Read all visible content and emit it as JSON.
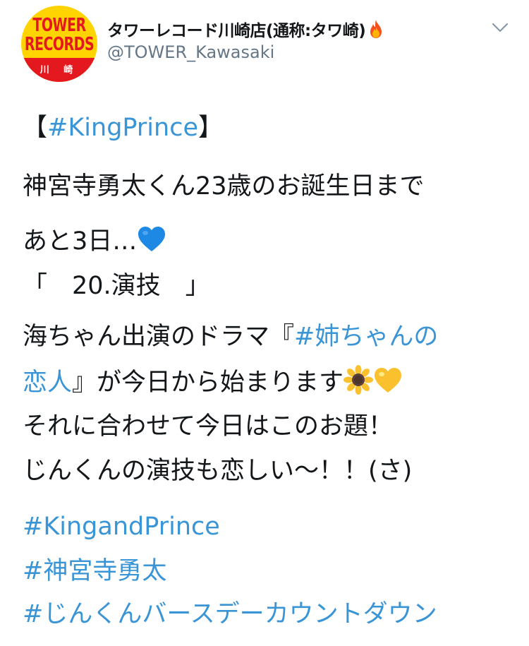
{
  "user": {
    "display_name": "タワーレコード川崎店(通称:タワ崎)",
    "handle": "@TOWER_Kawasaki",
    "avatar": {
      "logo_line1": "TOWER",
      "logo_line2": "RECORDS",
      "branch": "川 崎"
    },
    "name_emoji": "fire-icon"
  },
  "tweet": {
    "l1_open": "【",
    "l1_tag": "#KingPrince",
    "l1_close": "】",
    "l2": "神宮寺勇太くん23歳のお誕生日まで",
    "l3": "あと3日…",
    "l3_emoji": "blue-heart-icon",
    "l4": "「　20.演技　」",
    "l5_pre": "海ちゃん出演のドラマ『",
    "l5_tag": "#姉ちゃんの",
    "l6_tag": "恋人",
    "l6_post": "』が今日から始まります",
    "l6_emojis": [
      "sunflower-icon",
      "yellow-heart-icon"
    ],
    "l7": "それに合わせて今日はこのお題！",
    "l8": "じんくんの演技も恋しい〜！！(さ)",
    "hashtags": [
      "#KingandPrince",
      "#神宮寺勇太",
      "#じんくんバースデーカウントダウン"
    ]
  },
  "colors": {
    "link": "#3a95d6",
    "text": "#14171a",
    "secondary": "#657786",
    "logo_red": "#e3191f",
    "logo_yellow": "#ffd400"
  }
}
